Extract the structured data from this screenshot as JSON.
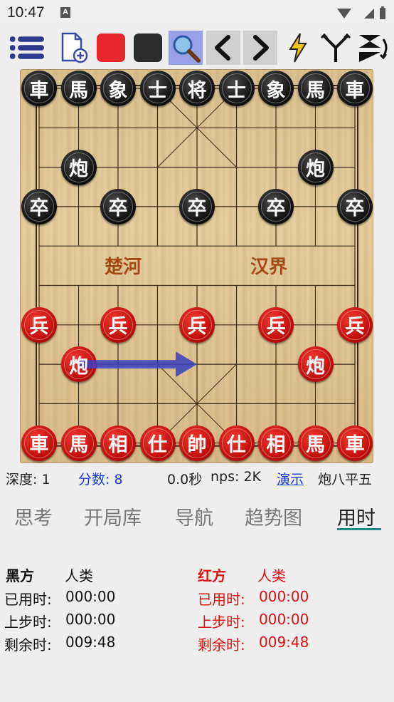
{
  "status_bar": {
    "time": "10:47",
    "notification": "A"
  },
  "toolbar": {
    "buttons": [
      "menu-icon",
      "new-file-icon",
      "red-square-icon",
      "black-square-icon",
      "search-icon",
      "prev-icon",
      "next-icon",
      "lightning-icon",
      "branch-icon",
      "flip-icon"
    ]
  },
  "board": {
    "river_left": "楚河",
    "river_right": "汉界",
    "pieces": [
      {
        "char": "車",
        "side": "black",
        "col": 0,
        "row": 0
      },
      {
        "char": "馬",
        "side": "black",
        "col": 1,
        "row": 0
      },
      {
        "char": "象",
        "side": "black",
        "col": 2,
        "row": 0
      },
      {
        "char": "士",
        "side": "black",
        "col": 3,
        "row": 0
      },
      {
        "char": "将",
        "side": "black",
        "col": 4,
        "row": 0
      },
      {
        "char": "士",
        "side": "black",
        "col": 5,
        "row": 0
      },
      {
        "char": "象",
        "side": "black",
        "col": 6,
        "row": 0
      },
      {
        "char": "馬",
        "side": "black",
        "col": 7,
        "row": 0
      },
      {
        "char": "車",
        "side": "black",
        "col": 8,
        "row": 0
      },
      {
        "char": "炮",
        "side": "black",
        "col": 1,
        "row": 2
      },
      {
        "char": "炮",
        "side": "black",
        "col": 7,
        "row": 2
      },
      {
        "char": "卒",
        "side": "black",
        "col": 0,
        "row": 3
      },
      {
        "char": "卒",
        "side": "black",
        "col": 2,
        "row": 3
      },
      {
        "char": "卒",
        "side": "black",
        "col": 4,
        "row": 3
      },
      {
        "char": "卒",
        "side": "black",
        "col": 6,
        "row": 3
      },
      {
        "char": "卒",
        "side": "black",
        "col": 8,
        "row": 3
      },
      {
        "char": "兵",
        "side": "red",
        "col": 0,
        "row": 6
      },
      {
        "char": "兵",
        "side": "red",
        "col": 2,
        "row": 6
      },
      {
        "char": "兵",
        "side": "red",
        "col": 4,
        "row": 6
      },
      {
        "char": "兵",
        "side": "red",
        "col": 6,
        "row": 6
      },
      {
        "char": "兵",
        "side": "red",
        "col": 8,
        "row": 6
      },
      {
        "char": "炮",
        "side": "red",
        "col": 1,
        "row": 7
      },
      {
        "char": "炮",
        "side": "red",
        "col": 7,
        "row": 7
      },
      {
        "char": "車",
        "side": "red",
        "col": 0,
        "row": 9
      },
      {
        "char": "馬",
        "side": "red",
        "col": 1,
        "row": 9
      },
      {
        "char": "相",
        "side": "red",
        "col": 2,
        "row": 9
      },
      {
        "char": "仕",
        "side": "red",
        "col": 3,
        "row": 9
      },
      {
        "char": "帥",
        "side": "red",
        "col": 4,
        "row": 9
      },
      {
        "char": "仕",
        "side": "red",
        "col": 5,
        "row": 9
      },
      {
        "char": "相",
        "side": "red",
        "col": 6,
        "row": 9
      },
      {
        "char": "馬",
        "side": "red",
        "col": 7,
        "row": 9
      },
      {
        "char": "車",
        "side": "red",
        "col": 8,
        "row": 9
      }
    ],
    "arrow": {
      "from_col": 1,
      "from_row": 7,
      "to_col": 4,
      "to_row": 7
    }
  },
  "info": {
    "depth": "深度: 1",
    "score": "分数: 8",
    "time": "0.0秒",
    "nps": "nps: 2K",
    "demo_link": "演示",
    "best_move": "炮八平五"
  },
  "tabs": [
    "思考",
    "开局库",
    "导航",
    "趋势图",
    "用时"
  ],
  "active_tab": "用时",
  "black_side": {
    "title": "黑方",
    "player": "人类",
    "used_label": "已用时:",
    "used_value": "000:00",
    "last_label": "上步时:",
    "last_value": "000:00",
    "remain_label": "剩余时:",
    "remain_value": "009:48"
  },
  "red_side": {
    "title": "红方",
    "player": "人类",
    "used_label": "已用时:",
    "used_value": "000:00",
    "last_label": "上步时:",
    "last_value": "000:00",
    "remain_label": "剩余时:",
    "remain_value": "009:48"
  },
  "colors": {
    "red": "#e01010",
    "link": "#1a3bd0",
    "accent": "#1e8a8a",
    "arrow": "#3a3fbf"
  }
}
